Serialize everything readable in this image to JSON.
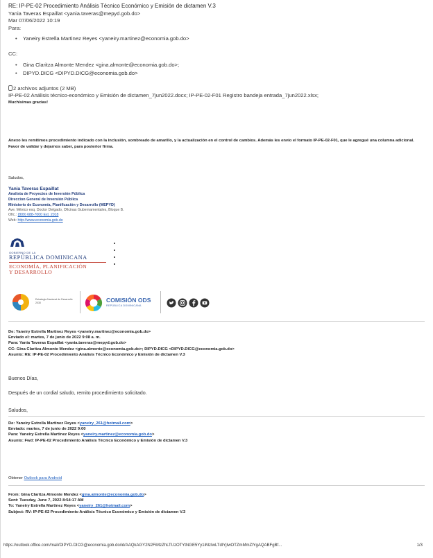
{
  "header": {
    "subject": "RE: IP-PE-02 Procedimiento Análisis Técnico Económico y Emisión de dictamen V.3",
    "from": "Yania Taveras Espaillat <yania.taveras@mepyd.gob.do>",
    "date": "Mar 07/06/2022 10:19",
    "para_label": "Para:",
    "para": [
      "Yaneiry Estrella Martinez Reyes <yaneiry.martinez@economia.gob.do>"
    ],
    "cc_label": "CC:",
    "cc": [
      "Gina Claritza Almonte Mendez <gina.almonte@economia.gob.do>;",
      "DIPYD.DICG <DIPYD.DICG@economia.gob.do>"
    ],
    "attachments_label": "2 archivos adjuntos (2 MB)",
    "attachments": "IP-PE-02 Análisis técnico-económico y Emisión de dictamen_7jun2022.docx; IP-PE-02-F01 Registro bandeja entrada_7jun2022.xlsx;"
  },
  "body": {
    "greeting": "Muchísimas gracias!",
    "p1": "Anexo les remitimos procedimiento indicado con la inclusión, sombreado de amarillo, y la actualización en el control de cambios.  Además les envío el formato IP-PE-02-F01, que le agregué una columna adicional.",
    "p2": "Favor de validar y dejarnos saber, para posterior firma.",
    "closing": "Saludos,"
  },
  "signature": {
    "name": "Yania Taveras Espaillat",
    "title": "Analista de Proyectos de Inversión Pública",
    "dept": "Direccion General de Inversión Pública",
    "ministry": "Ministerio de Economía, Planificación y Desarrollo (MEPYD)",
    "address": "Ave. México esq. Doctor Delgado, Oficinas Gubernamentales, Bloque B.",
    "phone_label": "Ofic.:",
    "phone": "(809) 688-7000 Ext. 2018",
    "web_label": "Web:",
    "web": "http://www.economia.gob.do"
  },
  "logo": {
    "gov_small": "GOBIERNO DE LA",
    "gov_big": "REPÚBLICA DOMINICANA",
    "ministry_line1": "ECONOMÍA, PLANIFICACIÓN",
    "ministry_line2": "Y DESARROLLO"
  },
  "brands": {
    "estrategia": "Estrategia Nacional de Desarrollo 2030",
    "comision": "COMISIÓN ODS",
    "comision_sub": "REPÚBLICA DOMINICANA"
  },
  "fw1": {
    "de": "De: Yaneiry Estrella Martinez Reyes <yaneiry.martinez@economia.gob.do>",
    "enviado": "Enviado el: martes, 7 de junio de 2022 9:08 a. m.",
    "para": "Para: Yania Taveras Espaillat <yania.taveras@mepyd.gob.do>",
    "cc": "CC: Gina Claritza Almonte Mendez <gina.almonte@economia.gob.do>; DIPYD.DICG <DIPYD.DICG@economia.gob.do>",
    "asunto": "Asunto: RE: IP-PE-02 Procedimiento Análisis Técnico Económico y Emisión de dictamen V.3",
    "greeting": "Buenos Días,",
    "text": "Después de un cordial saludo, remito procedimiento solicitado.",
    "closing": "Saludos,"
  },
  "fw2": {
    "de_prefix": "De: Yaneiry Estrella Martinez Reyes <",
    "de_link": "yaneiry_261@hotmail.com",
    "de_suffix": ">",
    "enviado": "Enviado: martes, 7 de junio de 2022 9:00",
    "para_prefix": "Para: Yaneiry Estrella Martinez Reyes <",
    "para_link": "yaneiry.martinez@economia.gob.do",
    "para_suffix": ">",
    "asunto": "Asunto: Fwd: IP-PE-02 Procedimiento Análisis Técnico Económico y Emisión de dictamen V.3",
    "obtener": "Obtener",
    "outlook_link": "Outlook para Android"
  },
  "fw3": {
    "from_prefix": "From: Gina Claritza Almonte Mendez <",
    "from_link": "gina.almonte@economia.gob.do",
    "from_suffix": ">",
    "sent": "Sent: Tuesday, June 7, 2022 8:54:17 AM",
    "to_prefix": "To: Yaneiry Estrella Martinez Reyes <",
    "to_link": "yaneiry_261@hotmail.com",
    "to_suffix": ">",
    "subject": "Subject: RV: IP-PE-02 Procedimiento Análisis Técnico Económico y Emisión de dictamen V.3"
  },
  "footer": {
    "url": "https://outlook.office.com/mail/DIPYD.DICG@economia.gob.do/id/AAQkAGY2N2FiMzZhLTUzOTYtNGE5Yy1iMzIwLTdlYjIwOTZmMmZlYgAQABFgBf...",
    "page": "1/3"
  },
  "colors": {
    "link": "#1f5fbf",
    "signature": "#1f3a7a",
    "ministry_red": "#c0392b"
  }
}
